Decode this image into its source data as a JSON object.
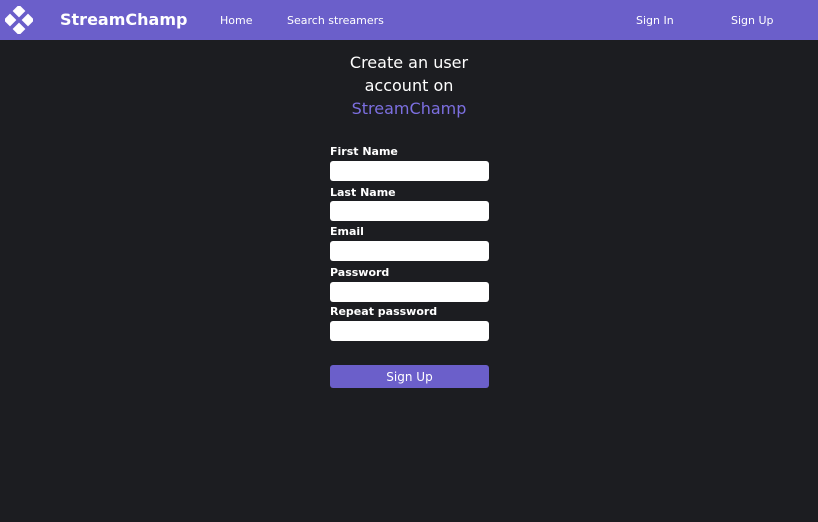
{
  "header": {
    "logo_icon": "diamond-grid-icon",
    "brand": "StreamChamp",
    "nav": {
      "home": "Home",
      "search": "Search streamers",
      "sign_in": "Sign In",
      "sign_up": "Sign Up"
    }
  },
  "form": {
    "title_line1": "Create an user",
    "title_line2": "account on",
    "title_brand": "StreamChamp",
    "fields": [
      {
        "label": "First Name",
        "value": ""
      },
      {
        "label": "Last Name",
        "value": ""
      },
      {
        "label": "Email",
        "value": ""
      },
      {
        "label": "Password",
        "value": ""
      },
      {
        "label": "Repeat password",
        "value": ""
      }
    ],
    "submit_label": "Sign Up"
  },
  "colors": {
    "accent": "#6b5fca",
    "brand_text": "#7c6fe0",
    "background": "#1c1d21"
  }
}
